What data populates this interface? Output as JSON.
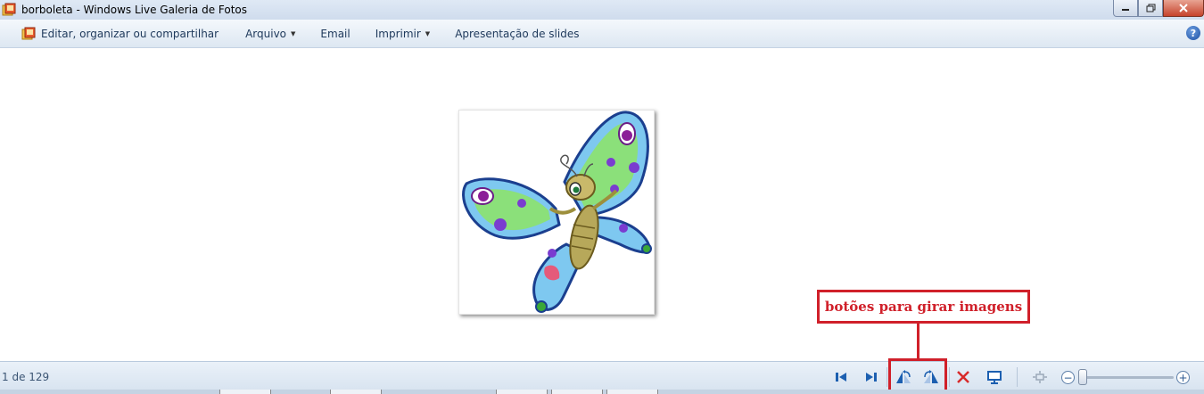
{
  "window": {
    "title": "borboleta - Windows Live Galeria de Fotos"
  },
  "menu": {
    "items": [
      {
        "label": "Editar, organizar ou compartilhar",
        "has_caret": false
      },
      {
        "label": "Arquivo",
        "has_caret": true
      },
      {
        "label": "Email",
        "has_caret": false
      },
      {
        "label": "Imprimir",
        "has_caret": true
      },
      {
        "label": "Apresentação de slides",
        "has_caret": false
      }
    ],
    "help": "?"
  },
  "annotation": {
    "label": "botões para girar imagens",
    "color": "#d0202a"
  },
  "status": {
    "counter": "1 de 129"
  },
  "toolbar": {
    "buttons": [
      "previous-icon",
      "next-icon",
      "rotate-left-icon",
      "rotate-right-icon",
      "delete-icon",
      "slideshow-icon",
      "fit-window-icon",
      "zoom-out-icon",
      "zoom-in-icon"
    ],
    "zoom_out": "−",
    "zoom_in": "+"
  },
  "colors": {
    "titlebar": "#dfe9f5",
    "menubar": "#e8eff7",
    "accent": "#1b5fa8",
    "delete": "#d82a2a"
  }
}
